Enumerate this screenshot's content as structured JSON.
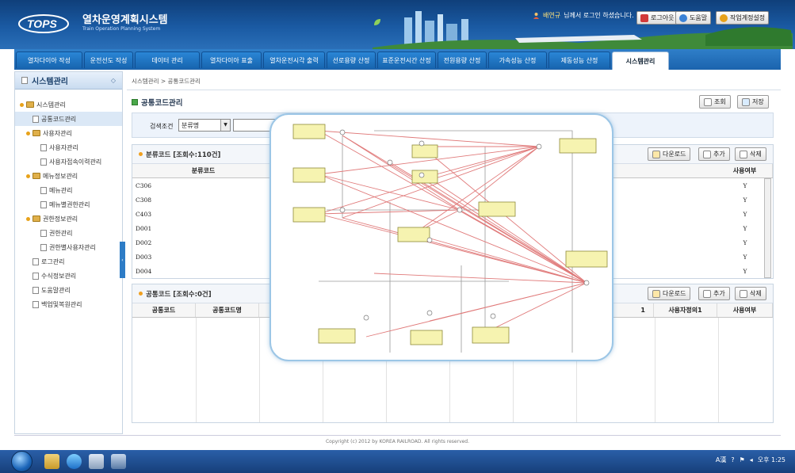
{
  "header": {
    "app_title": "열차운영계획시스템",
    "app_subtitle": "Train Operation Planning System",
    "logo_text": "TOPS",
    "user_name": "배연규",
    "user_greeting": "님께서 로그인 하셨습니다.",
    "logout_label": "로그아웃",
    "help_label": "도움말",
    "workspace_label": "작업계정설정"
  },
  "nav": {
    "tabs": [
      {
        "label": "열차다이아 작성"
      },
      {
        "label": "운전선도 작성"
      },
      {
        "label": "데이터 관리"
      },
      {
        "label": "열차다이아 표출"
      },
      {
        "label": "열차운전시각 출력"
      },
      {
        "label": "선로용량 산정"
      },
      {
        "label": "표준운전시간 산정"
      },
      {
        "label": "전원용량 산정"
      },
      {
        "label": "가속성능 산정"
      },
      {
        "label": "제동성능 산정"
      },
      {
        "label": "시스템관리"
      }
    ],
    "active": "시스템관리"
  },
  "sidebar": {
    "title": "시스템관리",
    "collapse_glyph": "◇",
    "tab_glyph": "‹",
    "items": [
      {
        "label": "시스템관리"
      },
      {
        "label": "공통코드관리"
      },
      {
        "label": "사용자관리"
      },
      {
        "label": "사용자관리"
      },
      {
        "label": "사용자접속이력관리"
      },
      {
        "label": "메뉴정보관리"
      },
      {
        "label": "메뉴관리"
      },
      {
        "label": "메뉴별권한관리"
      },
      {
        "label": "권한정보관리"
      },
      {
        "label": "권한관리"
      },
      {
        "label": "권한별사용자관리"
      },
      {
        "label": "로그관리"
      },
      {
        "label": "수식정보관리"
      },
      {
        "label": "도움말관리"
      },
      {
        "label": "백업및복원관리"
      }
    ]
  },
  "main": {
    "breadcrumb": "시스템관리 > 공통코드관리",
    "title": "공통코드관리",
    "search_button": "조회",
    "save_button": "저장",
    "search": {
      "label": "검색조건",
      "selected": "분류명",
      "arrow_glyph": "▼",
      "value": ""
    },
    "category_section": {
      "title": "분류코드 [조회수:110건]",
      "download": "다운로드",
      "add": "추가",
      "delete": "삭제",
      "columns": [
        "분류코드",
        "사용여부"
      ],
      "rows": [
        {
          "code": "C306",
          "use": "Y"
        },
        {
          "code": "C308",
          "use": "Y"
        },
        {
          "code": "C403",
          "use": "Y"
        },
        {
          "code": "D001",
          "use": "Y"
        },
        {
          "code": "D002",
          "use": "Y"
        },
        {
          "code": "D003",
          "use": "Y"
        },
        {
          "code": "D004",
          "use": "Y"
        }
      ]
    },
    "common_section": {
      "title": "공통코드 [조회수:0건]",
      "download": "다운로드",
      "add": "추가",
      "delete": "삭제",
      "columns": [
        "공통코드",
        "공통코드명",
        "1",
        "사용자정의1",
        "사용여부"
      ]
    }
  },
  "footer": {
    "copyright": "Copyright (c) 2012 by KOREA RAILROAD.  All rights reserved."
  },
  "taskbar": {
    "clock": "오후 1:25",
    "ime": "A漢"
  },
  "colors": {
    "header_blue": "#1a5aa3",
    "nav_blue": "#2a86d6",
    "diagram_line": "#e07a7a",
    "component_fill": "#f6f3b0"
  }
}
